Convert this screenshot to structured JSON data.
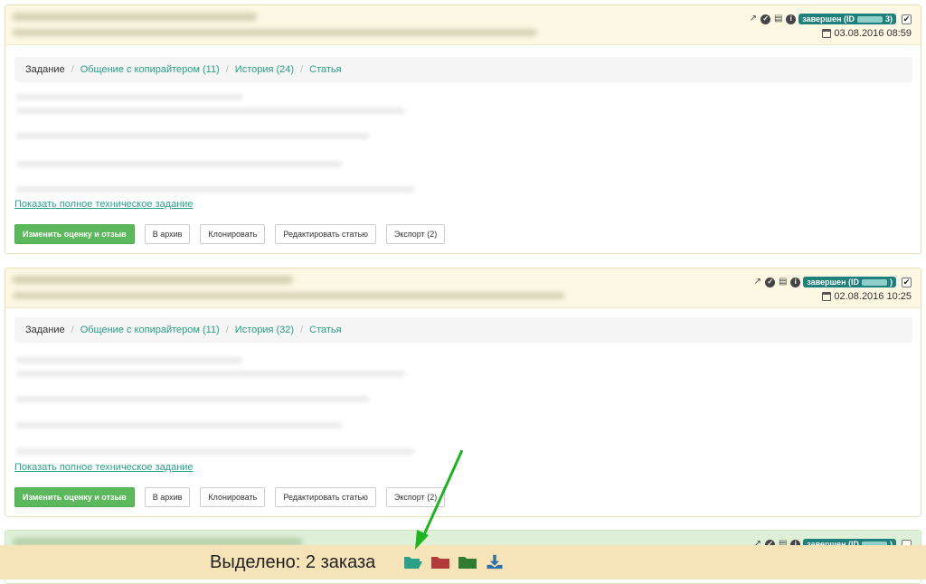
{
  "orders": [
    {
      "status": "завершен (ID",
      "status_suffix": "3)",
      "date": "03.08.2016 08:59",
      "tabs": [
        "Задание",
        "Общение с копирайтером (11)",
        "История (24)",
        "Статья"
      ],
      "show_full": "Показать полное техническое задание",
      "buttons": [
        "Изменить оценку и отзыв",
        "В архив",
        "Клонировать",
        "Редактировать статью",
        "Экспорт (2)"
      ]
    },
    {
      "status": "завершен (ID",
      "status_suffix": ")",
      "date": "02.08.2016 10:25",
      "tabs": [
        "Задание",
        "Общение с копирайтером (11)",
        "История (32)",
        "Статья"
      ],
      "show_full": "Показать полное техническое задание",
      "buttons": [
        "Изменить оценку и отзыв",
        "В архив",
        "Клонировать",
        "Редактировать статью",
        "Экспорт (2)"
      ]
    },
    {
      "status": "завершен (ID",
      "status_suffix": ")"
    }
  ],
  "bottom_bar": {
    "selected_text": "Выделено: 2 заказа",
    "icons": [
      "folder-open-icon",
      "folder-red-icon",
      "folder-green-icon",
      "download-icon"
    ]
  },
  "colors": {
    "accent": "#2aa089",
    "primary_button": "#5cb85c",
    "status_badge": "#1f7f7a",
    "arrow": "#1fb31f",
    "bar": "#f7e3b8"
  }
}
